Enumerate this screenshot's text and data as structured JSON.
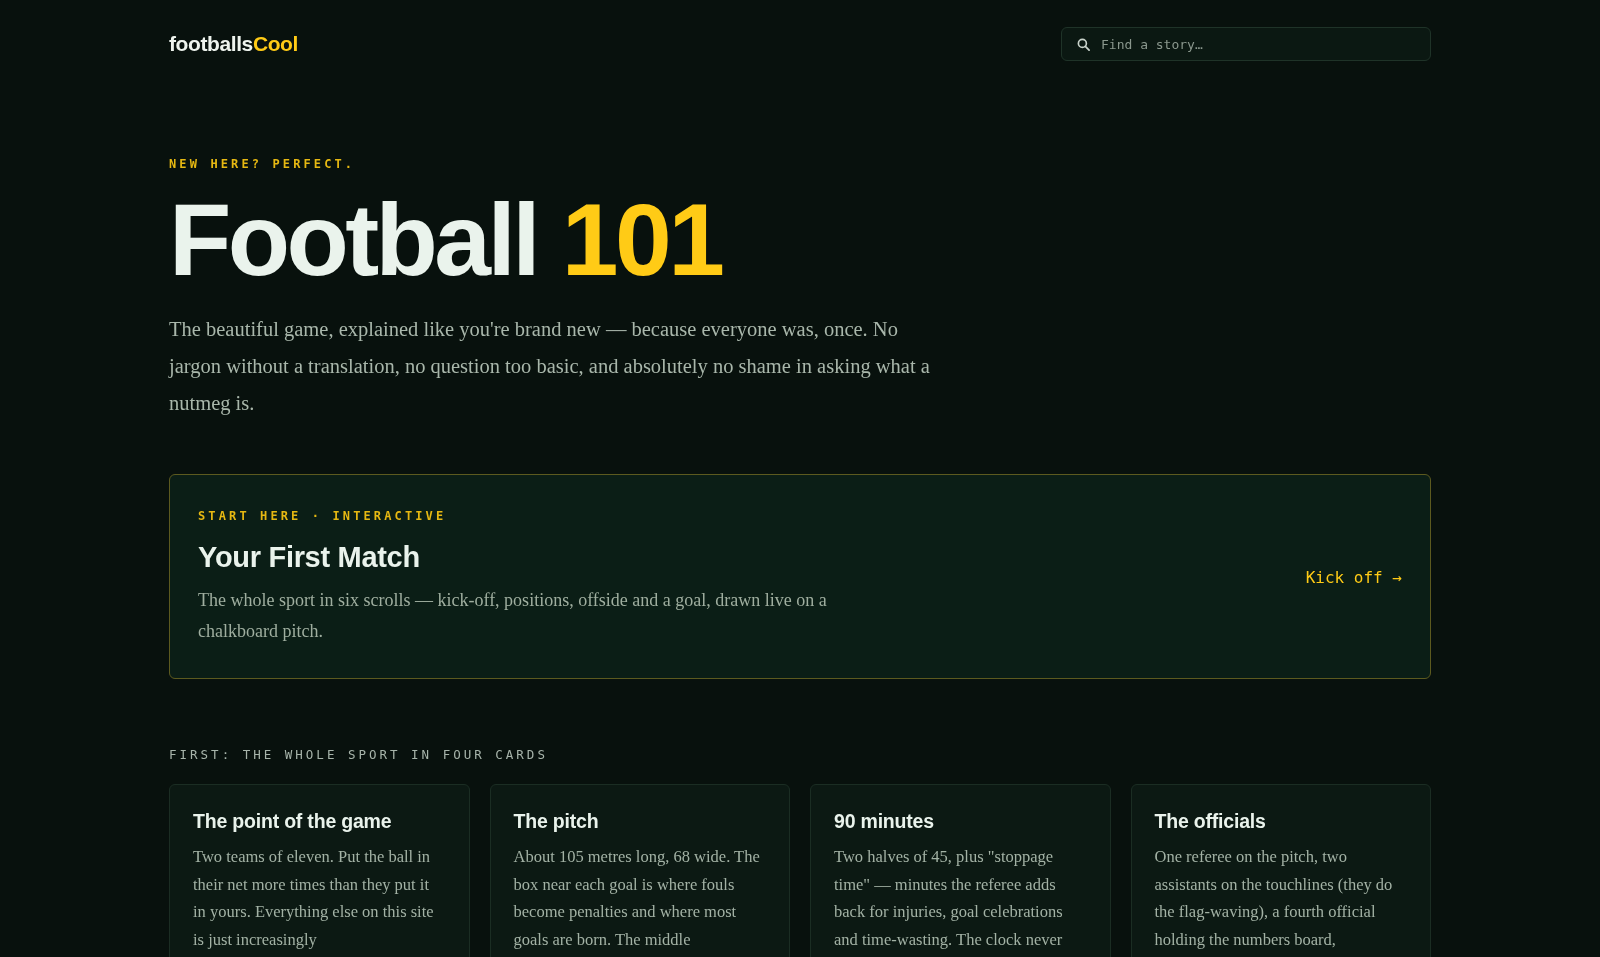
{
  "header": {
    "logo": {
      "text": "footballs",
      "accent": "Cool"
    },
    "search": {
      "placeholder": "Find a story…"
    }
  },
  "hero": {
    "eyebrow": "NEW HERE? PERFECT.",
    "title": "Football",
    "title_accent": "101",
    "intro": "The beautiful game, explained like you're brand new — because everyone was, once. No jargon without a translation, no question too basic, and absolutely no shame in asking what a nutmeg is."
  },
  "featured": {
    "eyebrow": "START HERE · INTERACTIVE",
    "title": "Your First Match",
    "description": "The whole sport in six scrolls — kick-off, positions, offside and a goal, drawn live on a chalkboard pitch.",
    "link": "Kick off →"
  },
  "section": {
    "label": "FIRST: THE WHOLE SPORT IN FOUR CARDS",
    "cards": [
      {
        "title": "The point of the game",
        "body": "Two teams of eleven. Put the ball in their net more times than they put it in yours. Everything else on this site is just increasingly"
      },
      {
        "title": "The pitch",
        "body": "About 105 metres long, 68 wide. The box near each goal is where fouls become penalties and where most goals are born. The middle"
      },
      {
        "title": "90 minutes",
        "body": "Two halves of 45, plus \"stoppage time\" — minutes the referee adds back for injuries, goal celebrations and time-wasting. The clock never"
      },
      {
        "title": "The officials",
        "body": "One referee on the pitch, two assistants on the touchlines (they do the flag-waving), a fourth official holding the numbers board,"
      }
    ]
  }
}
